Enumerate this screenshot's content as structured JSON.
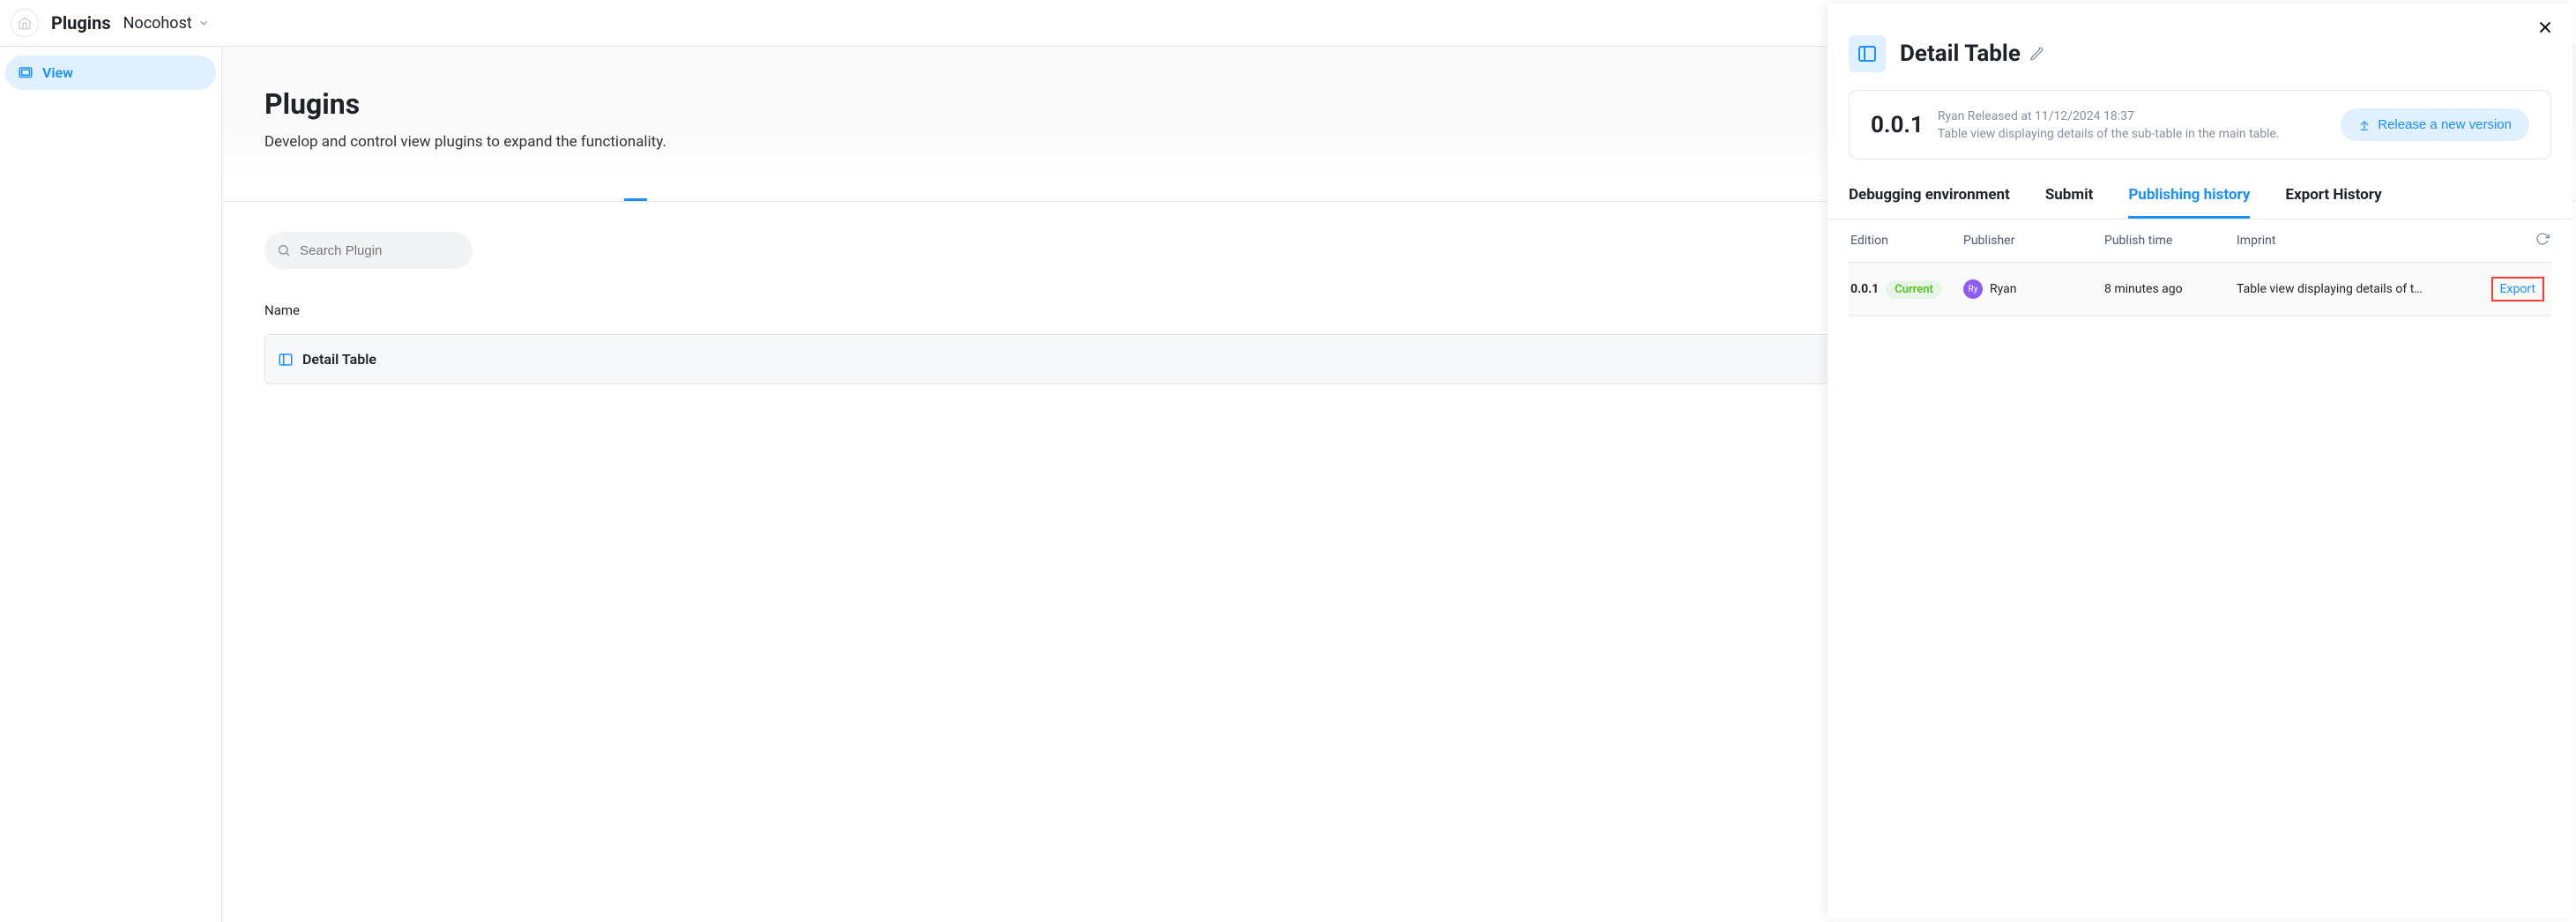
{
  "topbar": {
    "title": "Plugins",
    "workspace": "Nocohost"
  },
  "sidebar": {
    "items": [
      {
        "label": "View"
      }
    ]
  },
  "content": {
    "heading": "Plugins",
    "subheading": "Develop and control view plugins to expand the functionality."
  },
  "search": {
    "placeholder": "Search Plugin"
  },
  "table": {
    "header_name": "Name",
    "rows": [
      {
        "name": "Detail Table"
      }
    ]
  },
  "drawer": {
    "title": "Detail Table",
    "version": {
      "number": "0.0.1",
      "meta": "Ryan Released at 11/12/2024 18:37",
      "desc": "Table view displaying details of the sub-table in the main table."
    },
    "release_button": "Release a new version",
    "tabs": {
      "debug": "Debugging environment",
      "submit": "Submit",
      "publishing": "Publishing history",
      "export": "Export History"
    },
    "history": {
      "headers": {
        "edition": "Edition",
        "publisher": "Publisher",
        "publish_time": "Publish time",
        "imprint": "Imprint"
      },
      "rows": [
        {
          "edition": "0.0.1",
          "badge": "Current",
          "publisher": "Ryan",
          "avatar_initials": "Ry",
          "time": "8 minutes ago",
          "imprint": "Table view displaying details of t…",
          "action": "Export"
        }
      ]
    }
  }
}
